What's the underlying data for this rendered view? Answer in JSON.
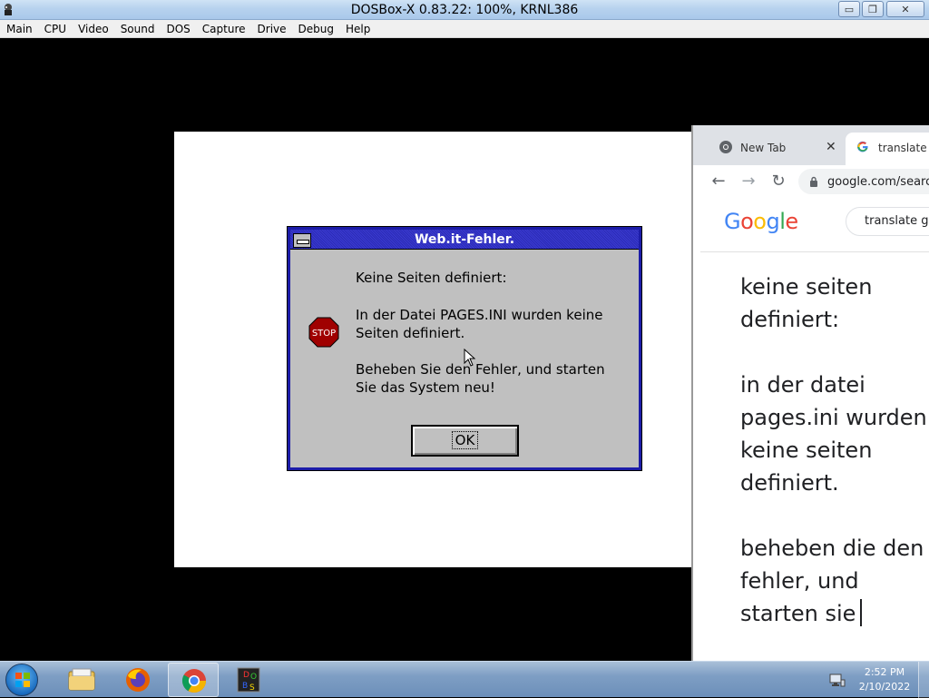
{
  "window": {
    "title": "DOSBox-X 0.83.22: 100%, KRNL386",
    "minimize_glyph": "▭",
    "maximize_glyph": "❐",
    "close_glyph": "✕"
  },
  "menubar": {
    "items": [
      "Main",
      "CPU",
      "Video",
      "Sound",
      "DOS",
      "Capture",
      "Drive",
      "Debug",
      "Help"
    ]
  },
  "dialog": {
    "title": "Web.it-Fehler.",
    "icon": "stop-icon",
    "icon_text": "STOP",
    "line1": "Keine Seiten definiert:",
    "line2a": "In der Datei PAGES.INI wurden keine",
    "line2b": "Seiten definiert.",
    "line3a": "Beheben Sie den Fehler, und starten",
    "line3b": "Sie das System neu!",
    "ok_label": "OK"
  },
  "browser": {
    "tabs": [
      {
        "label": "New Tab",
        "icon": "chrome-icon",
        "close": "✕"
      },
      {
        "label": "translate ge",
        "icon": "google-g-icon"
      }
    ],
    "url": "google.com/searc",
    "logo": "Google",
    "search_query": "translate ge",
    "translation": {
      "p1a": "keine seiten",
      "p1b": "definiert:",
      "p2a": "in der datei",
      "p2b": "pages.ini wurden",
      "p2c": "keine seiten",
      "p2d": "definiert.",
      "p3a": "beheben die den",
      "p3b": "fehler, und",
      "p3c": "starten sie"
    }
  },
  "taskbar": {
    "items": [
      "explorer-icon",
      "firefox-icon",
      "chrome-icon",
      "dosbox-icon"
    ],
    "active": "chrome-icon",
    "time": "2:52 PM",
    "date": "2/10/2022"
  }
}
